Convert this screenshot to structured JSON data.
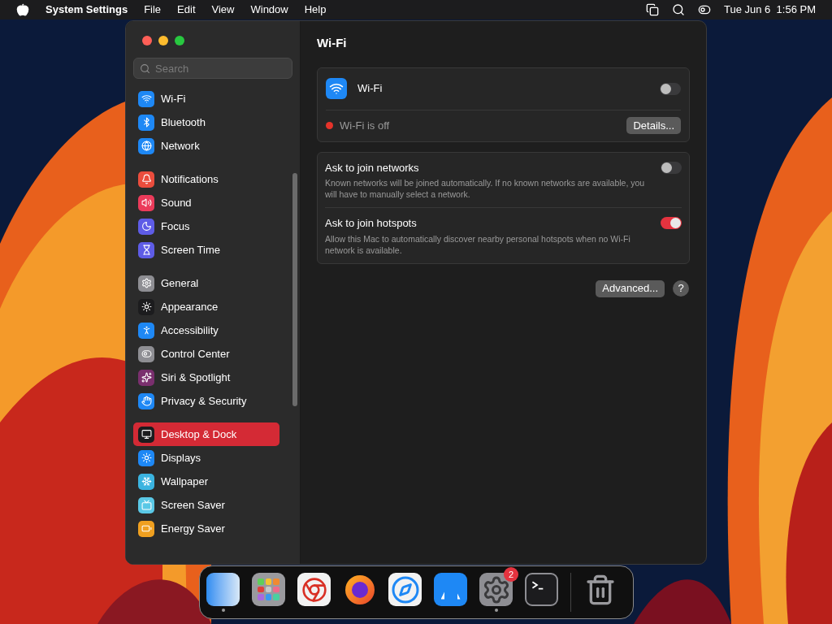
{
  "menu_bar": {
    "app": "System Settings",
    "menus": [
      "File",
      "Edit",
      "View",
      "Window",
      "Help"
    ],
    "clock": "Tue Jun 6  1:56 PM"
  },
  "sidebar": {
    "search": {
      "placeholder": "Search"
    },
    "groups": [
      [
        {
          "label": "Wi-Fi",
          "color": "#1e88f5",
          "selected": false
        },
        {
          "label": "Bluetooth",
          "color": "#1e88f5",
          "selected": false
        },
        {
          "label": "Network",
          "color": "#1e88f5",
          "selected": false
        }
      ],
      [
        {
          "label": "Notifications",
          "color": "#eb4d3d",
          "selected": false
        },
        {
          "label": "Sound",
          "color": "#eb3b5a",
          "selected": false
        },
        {
          "label": "Focus",
          "color": "#5e5ce6",
          "selected": false
        },
        {
          "label": "Screen Time",
          "color": "#5e5ce6",
          "selected": false
        }
      ],
      [
        {
          "label": "General",
          "color": "#8e8e93",
          "selected": false
        },
        {
          "label": "Appearance",
          "color": "#1c1c1e",
          "selected": false
        },
        {
          "label": "Accessibility",
          "color": "#1e88f5",
          "selected": false
        },
        {
          "label": "Control Center",
          "color": "#8e8e93",
          "selected": false
        },
        {
          "label": "Siri & Spotlight",
          "color": "#7a2f6e",
          "selected": false
        },
        {
          "label": "Privacy & Security",
          "color": "#1e88f5",
          "selected": false
        }
      ],
      [
        {
          "label": "Desktop & Dock",
          "color": "#1c1c1e",
          "selected": true
        },
        {
          "label": "Displays",
          "color": "#1e88f5",
          "selected": false
        },
        {
          "label": "Wallpaper",
          "color": "#3bb4e0",
          "selected": false
        },
        {
          "label": "Screen Saver",
          "color": "#5ac8e6",
          "selected": false
        },
        {
          "label": "Energy Saver",
          "color": "#f0a020",
          "selected": false
        }
      ]
    ]
  },
  "content": {
    "title": "Wi-Fi",
    "wifi_card": {
      "label": "Wi-Fi",
      "on": false,
      "status": {
        "text": "Wi-Fi is off",
        "color": "#e5332a"
      },
      "button": "Details..."
    },
    "options": [
      {
        "title": "Ask to join networks",
        "description": "Known networks will be joined automatically. If no known networks are available, you will have to manually select a network.",
        "on": false
      },
      {
        "title": "Ask to join hotspots",
        "description": "Allow this Mac to automatically discover nearby personal hotspots when no Wi-Fi network is available.",
        "on": true
      }
    ],
    "buttons": [
      "Advanced...",
      "?"
    ]
  },
  "dock": [
    {
      "running": true
    },
    {
      "running": false
    },
    {
      "running": false
    },
    {
      "running": false
    },
    {
      "running": false
    },
    {
      "running": false
    },
    {
      "running": true,
      "badge": "2"
    },
    {
      "running": false
    },
    {
      "running": false
    }
  ]
}
